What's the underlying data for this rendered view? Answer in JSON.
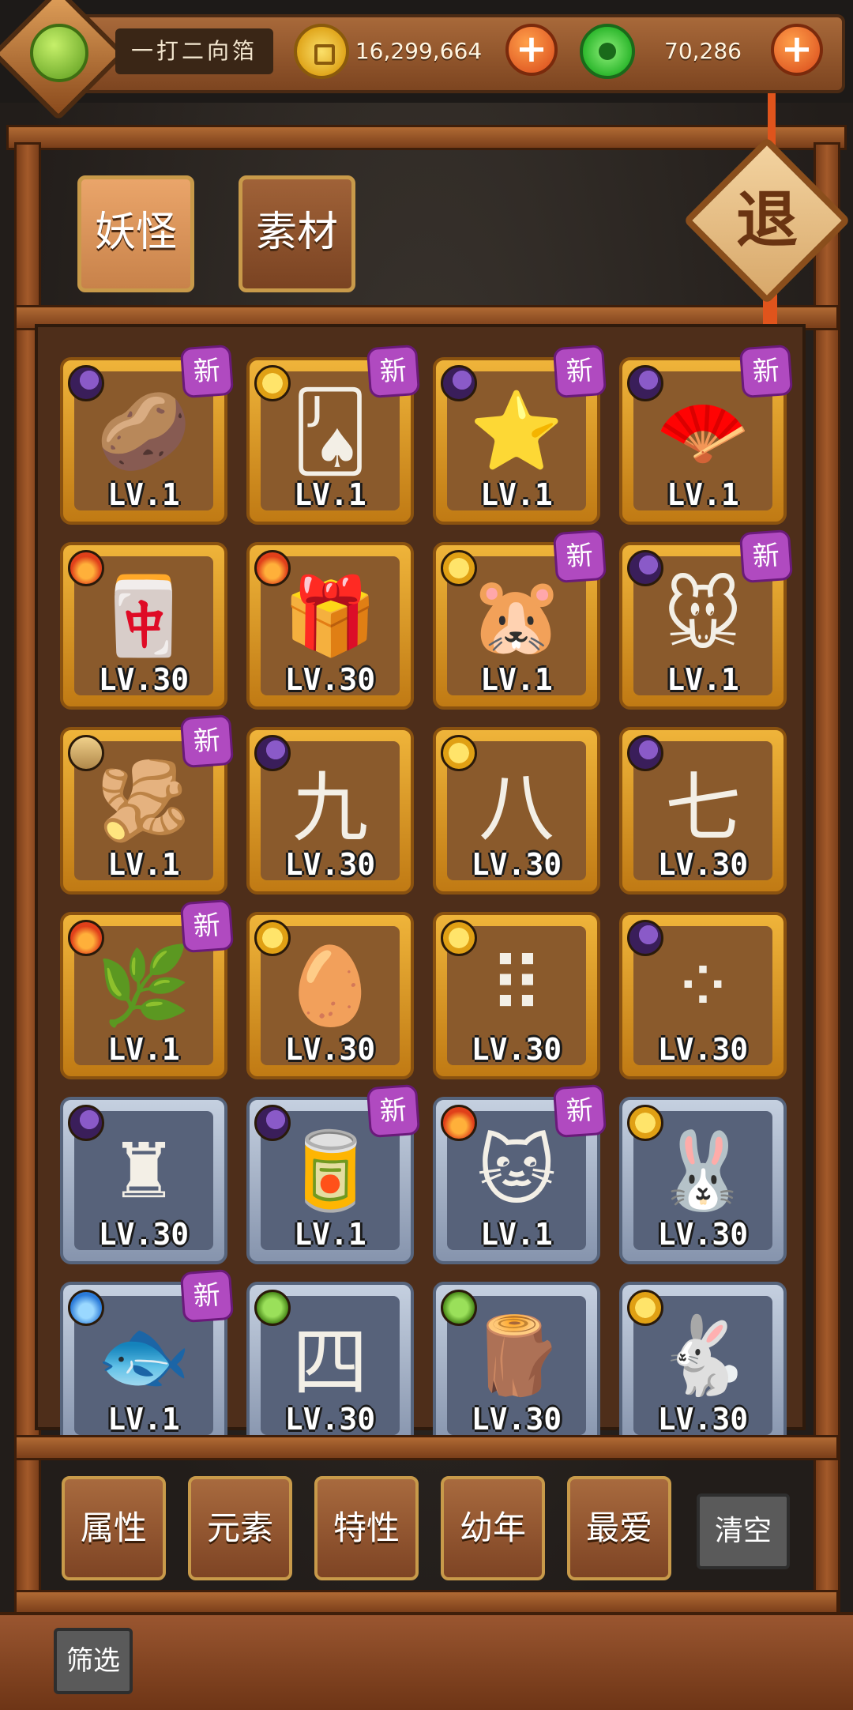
{
  "header": {
    "player_name": "一打二向箔",
    "gold_amount": "16,299,664",
    "jade_amount": "70,286",
    "gold_icon": "gold-coin-icon",
    "jade_icon": "jade-coin-icon",
    "add_icon": "plus-icon"
  },
  "tabs": {
    "monsters": "妖怪",
    "materials": "素材"
  },
  "exit_label": "退",
  "new_label": "新",
  "cards": [
    {
      "element": "moon",
      "frame": "gold",
      "level": "LV.1",
      "is_new": true,
      "art": "🥔"
    },
    {
      "element": "sun",
      "frame": "gold",
      "level": "LV.1",
      "is_new": true,
      "art": "🂫"
    },
    {
      "element": "moon",
      "frame": "gold",
      "level": "LV.1",
      "is_new": true,
      "art": "⭐"
    },
    {
      "element": "moon",
      "frame": "gold",
      "level": "LV.1",
      "is_new": true,
      "art": "🪭"
    },
    {
      "element": "fire",
      "frame": "gold",
      "level": "LV.30",
      "is_new": false,
      "art": "🀄"
    },
    {
      "element": "fire",
      "frame": "gold",
      "level": "LV.30",
      "is_new": false,
      "art": "🎁"
    },
    {
      "element": "sun",
      "frame": "gold",
      "level": "LV.1",
      "is_new": true,
      "art": "🐹"
    },
    {
      "element": "moon",
      "frame": "gold",
      "level": "LV.1",
      "is_new": true,
      "art": "🐭"
    },
    {
      "element": "earth",
      "frame": "gold",
      "level": "LV.1",
      "is_new": true,
      "art": "🫚"
    },
    {
      "element": "moon",
      "frame": "gold",
      "level": "LV.30",
      "is_new": false,
      "art": "九"
    },
    {
      "element": "sun",
      "frame": "gold",
      "level": "LV.30",
      "is_new": false,
      "art": "八"
    },
    {
      "element": "moon",
      "frame": "gold",
      "level": "LV.30",
      "is_new": false,
      "art": "七"
    },
    {
      "element": "fire",
      "frame": "gold",
      "level": "LV.1",
      "is_new": true,
      "art": "🌿"
    },
    {
      "element": "sun",
      "frame": "gold",
      "level": "LV.30",
      "is_new": false,
      "art": "🥚"
    },
    {
      "element": "sun",
      "frame": "gold",
      "level": "LV.30",
      "is_new": false,
      "art": "⠿"
    },
    {
      "element": "moon",
      "frame": "gold",
      "level": "LV.30",
      "is_new": false,
      "art": "⁘"
    },
    {
      "element": "moon",
      "frame": "silver",
      "level": "LV.30",
      "is_new": false,
      "art": "♜"
    },
    {
      "element": "moon",
      "frame": "silver",
      "level": "LV.1",
      "is_new": true,
      "art": "🥫"
    },
    {
      "element": "fire",
      "frame": "silver",
      "level": "LV.1",
      "is_new": true,
      "art": "🐱"
    },
    {
      "element": "sun",
      "frame": "silver",
      "level": "LV.30",
      "is_new": false,
      "art": "🐰"
    },
    {
      "element": "water",
      "frame": "silver",
      "level": "LV.1",
      "is_new": true,
      "art": "🐟"
    },
    {
      "element": "leaf",
      "frame": "silver",
      "level": "LV.30",
      "is_new": false,
      "art": "四"
    },
    {
      "element": "leaf",
      "frame": "silver",
      "level": "LV.30",
      "is_new": false,
      "art": "🪵"
    },
    {
      "element": "sun",
      "frame": "silver",
      "level": "LV.30",
      "is_new": false,
      "art": "🐇"
    }
  ],
  "filters": [
    "属性",
    "元素",
    "特性",
    "幼年",
    "最爱"
  ],
  "clear_label": "清空",
  "screen_label": "筛选"
}
